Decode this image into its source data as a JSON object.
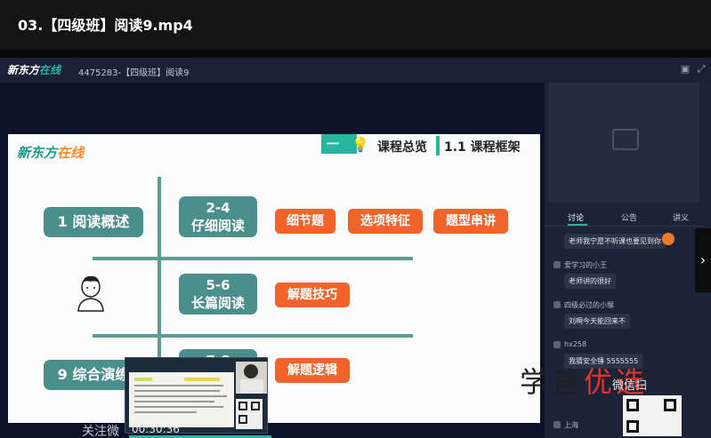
{
  "window": {
    "title": "03.【四级班】阅读9.mp4"
  },
  "app": {
    "logo_main": "新东方",
    "logo_accent": "在线",
    "course_title": "4475283-【四级班】阅读9"
  },
  "slide": {
    "logo_main": "新东方",
    "logo_accent": "在线",
    "section_number": "一",
    "section_title": "课程总览",
    "subsection_title": "1.1 课程框架",
    "left_boxes": [
      "1 阅读概述",
      "9 综合演练"
    ],
    "rows": [
      {
        "tag_top": "2-4",
        "tag_bottom": "仔细阅读",
        "items": [
          "细节题",
          "选项特征",
          "题型串讲"
        ]
      },
      {
        "tag_top": "5-6",
        "tag_bottom": "长篇阅读",
        "items": [
          "解题技巧"
        ]
      },
      {
        "tag_top": "7-8",
        "tag_bottom": "",
        "items": [
          "解题逻辑"
        ]
      }
    ],
    "colors": {
      "teal_box": "#4a8f8b",
      "orange_box": "#f0642c",
      "accent": "#26b59f"
    }
  },
  "player": {
    "timecode": "00:30:36",
    "overlay_text": "关注微"
  },
  "sidebar": {
    "tabs": [
      "讨论",
      "公告",
      "讲义"
    ],
    "messages": [
      {
        "name": "",
        "text": "老师我宁愿不听课也要见到你"
      },
      {
        "name": "爱学习的小王",
        "text": "老师讲的很好"
      },
      {
        "name": "四级必过的小猴",
        "text": "刘啊今天能回来不"
      },
      {
        "name": "hx258",
        "text": "我猜安全锤 5555555"
      },
      {
        "name": "上海",
        "text": ""
      }
    ]
  },
  "watermark": {
    "text_dark": "学爸",
    "text_red": "优选",
    "wechat": "微信扫"
  }
}
